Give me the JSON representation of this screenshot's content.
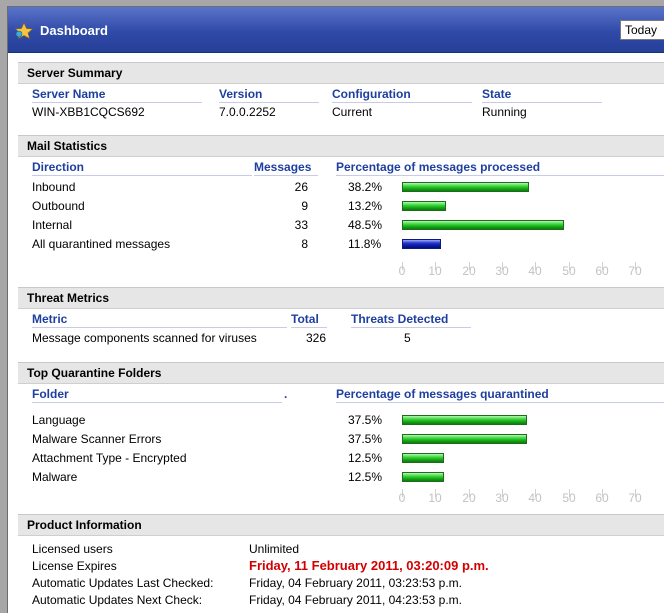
{
  "window": {
    "title": "Dashboard",
    "period": "Today"
  },
  "server_summary": {
    "heading": "Server Summary",
    "columns": [
      "Server Name",
      "Version",
      "Configuration",
      "State"
    ],
    "row": [
      "WIN-XBB1CQCS692",
      "7.0.0.2252",
      "Current",
      "Running"
    ]
  },
  "mail_statistics": {
    "heading": "Mail Statistics",
    "columns": [
      "Direction",
      "Messages",
      "Percentage of messages processed"
    ],
    "rows": [
      {
        "direction": "Inbound",
        "messages": "26",
        "percent": "38.2%",
        "value": 38.2,
        "color": "#22b522"
      },
      {
        "direction": "Outbound",
        "messages": "9",
        "percent": "13.2%",
        "value": 13.2,
        "color": "#22b522"
      },
      {
        "direction": "Internal",
        "messages": "33",
        "percent": "48.5%",
        "value": 48.5,
        "color": "#22b522"
      },
      {
        "direction": "All quarantined messages",
        "messages": "8",
        "percent": "11.8%",
        "value": 11.8,
        "color": "#1424b8"
      }
    ],
    "axis": [
      "0",
      "10",
      "20",
      "30",
      "40",
      "50",
      "60",
      "70"
    ]
  },
  "threat_metrics": {
    "heading": "Threat Metrics",
    "columns": [
      "Metric",
      "Total",
      "Threats Detected"
    ],
    "row": [
      "Message components scanned for viruses",
      "326",
      "5"
    ]
  },
  "quarantine": {
    "heading": "Top Quarantine Folders",
    "columns": [
      "Folder",
      ".",
      "Percentage of messages quarantined"
    ],
    "rows": [
      {
        "folder": "Language",
        "percent": "37.5%",
        "value": 37.5
      },
      {
        "folder": "Malware Scanner Errors",
        "percent": "37.5%",
        "value": 37.5
      },
      {
        "folder": "Attachment Type - Encrypted",
        "percent": "12.5%",
        "value": 12.5
      },
      {
        "folder": "Malware",
        "percent": "12.5%",
        "value": 12.5
      }
    ],
    "axis": [
      "0",
      "10",
      "20",
      "30",
      "40",
      "50",
      "60",
      "70"
    ]
  },
  "product_info": {
    "heading": "Product Information",
    "rows": [
      {
        "label": "Licensed users",
        "value": "Unlimited"
      },
      {
        "label": "License Expires",
        "value": "Friday, 11 February 2011, 03:20:09 p.m."
      },
      {
        "label": "Automatic Updates Last Checked:",
        "value": "Friday, 04 February 2011, 03:23:53 p.m."
      },
      {
        "label": "Automatic Updates Next Check:",
        "value": "Friday, 04 February 2011, 04:23:53 p.m."
      }
    ]
  },
  "colors": {
    "title_bar": "#2f4aa8",
    "header_text": "#1f3fa0",
    "bar_green": "#22b522",
    "bar_blue": "#1424b8",
    "expiry_red": "#d40000"
  },
  "icons": {
    "title": "star-icon"
  }
}
